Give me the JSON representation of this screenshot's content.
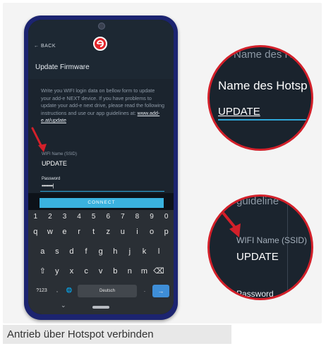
{
  "phone": {
    "back_label": "BACK",
    "page_title": "Update Firmware",
    "description": "Write you WIFI login data on bellow form to update your add-e NEXT device. If you have problems to update your add-e next drive, please read the following instructions and use our app guidelines at: ",
    "guidelines_link": "www.add-e.at/update",
    "ssid_label": "WIFI Name (SSID)",
    "ssid_value": "UPDATE",
    "password_label": "Password",
    "password_value": "••••••••|",
    "connect_label": "CONNECT"
  },
  "keyboard": {
    "numbers": [
      "1",
      "2",
      "3",
      "4",
      "5",
      "6",
      "7",
      "8",
      "9",
      "0"
    ],
    "row1": [
      "q",
      "w",
      "e",
      "r",
      "t",
      "z",
      "u",
      "i",
      "o",
      "p"
    ],
    "row2": [
      "a",
      "s",
      "d",
      "f",
      "g",
      "h",
      "j",
      "k",
      "l"
    ],
    "row3": [
      "⇧",
      "y",
      "x",
      "c",
      "v",
      "b",
      "n",
      "m",
      "⌫"
    ],
    "symbols_key": "?123",
    "comma_key": ",",
    "globe_key": "🌐",
    "space_label": "Deutsch",
    "period_key": ".",
    "enter_key": "→"
  },
  "zoom_top": {
    "partial_text": "Name des H",
    "title": "Name des Hotsp",
    "value": "UPDATE"
  },
  "zoom_bottom": {
    "partial_text": "guideline",
    "label": "WIFI Name (SSID)",
    "value": "UPDATE",
    "password_label": "Password"
  },
  "caption": "Antrieb über Hotspot verbinden",
  "colors": {
    "accent": "#d3202a",
    "connect": "#3ab2df",
    "phone_body": "#1c2470"
  }
}
